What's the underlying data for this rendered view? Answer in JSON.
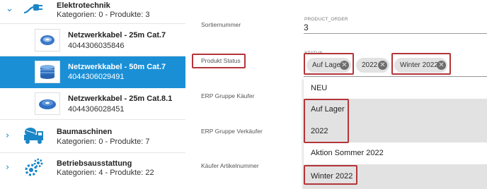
{
  "tree": {
    "categories": [
      {
        "title": "Elektrotechnik",
        "subtitle": "Kategorien: 0 - Produkte: 3",
        "icon": "plug-icon"
      },
      {
        "title": "Baumaschinen",
        "subtitle": "Kategorien: 0 - Produkte: 7",
        "icon": "cement-mixer-icon"
      },
      {
        "title": "Betriebsausstattung",
        "subtitle": "Kategorien: 4 - Produkte: 22",
        "icon": "gears-icon"
      }
    ],
    "products": [
      {
        "title": "Netzwerkkabel - 25m Cat.7",
        "sku": "4044306035846"
      },
      {
        "title": "Netzwerkkabel - 50m Cat.7",
        "sku": "4044306029491"
      },
      {
        "title": "Netzwerkkabel - 25m Cat.8.1",
        "sku": "4044306028451"
      }
    ]
  },
  "fields": {
    "sortiernummer": "Sortiernummer",
    "produkt_status": "Produkt Status",
    "erp_kaeufer": "ERP Gruppe Käufer",
    "erp_verkaeufer": "ERP Gruppe Verkäufer",
    "kaeufer_artikelnummer": "Käufer Artikelnummer"
  },
  "product_order": {
    "caption": "PRODUCT_ORDER",
    "value": "3"
  },
  "status": {
    "caption": "STATUS",
    "chips": [
      "Auf Lager",
      "2022",
      "Winter 2022"
    ],
    "remove_glyph": "✕"
  },
  "menu": {
    "options": [
      "NEU",
      "Auf Lager",
      "2022",
      "Aktion Sommer 2022",
      "Winter 2022"
    ]
  },
  "colors": {
    "selected_row": "#1a8fd6",
    "highlight_border": "#b3353a",
    "chip_bg": "#e2e2e2",
    "accent": "#1a86c8"
  }
}
